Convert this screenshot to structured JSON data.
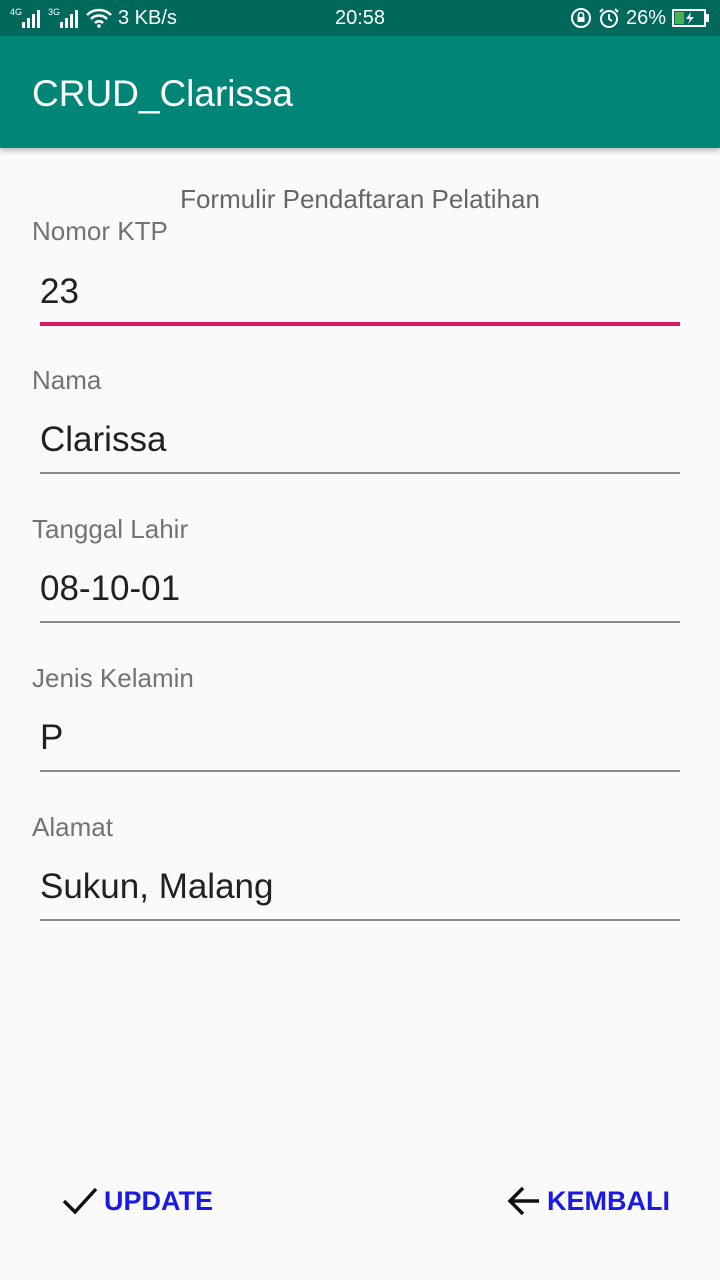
{
  "status_bar": {
    "network_1": "4G",
    "network_2": "3G",
    "speed": "3 KB/s",
    "time": "20:58",
    "battery": "26%"
  },
  "app_bar": {
    "title": "CRUD_Clarissa"
  },
  "form": {
    "title": "Formulir Pendaftaran Pelatihan",
    "fields": [
      {
        "label": "Nomor KTP",
        "value": "23"
      },
      {
        "label": "Nama",
        "value": "Clarissa"
      },
      {
        "label": "Tanggal Lahir",
        "value": "08-10-01"
      },
      {
        "label": "Jenis Kelamin",
        "value": "P"
      },
      {
        "label": "Alamat",
        "value": "Sukun, Malang"
      }
    ]
  },
  "actions": {
    "update_label": "UPDATE",
    "update_icon": "check-icon",
    "back_label": "KEMBALI",
    "back_icon": "arrow-left-icon"
  },
  "colors": {
    "app_bar": "#008577",
    "status_bar": "#00695c",
    "accent": "#d81b60",
    "button_text": "#1a1ae6"
  }
}
